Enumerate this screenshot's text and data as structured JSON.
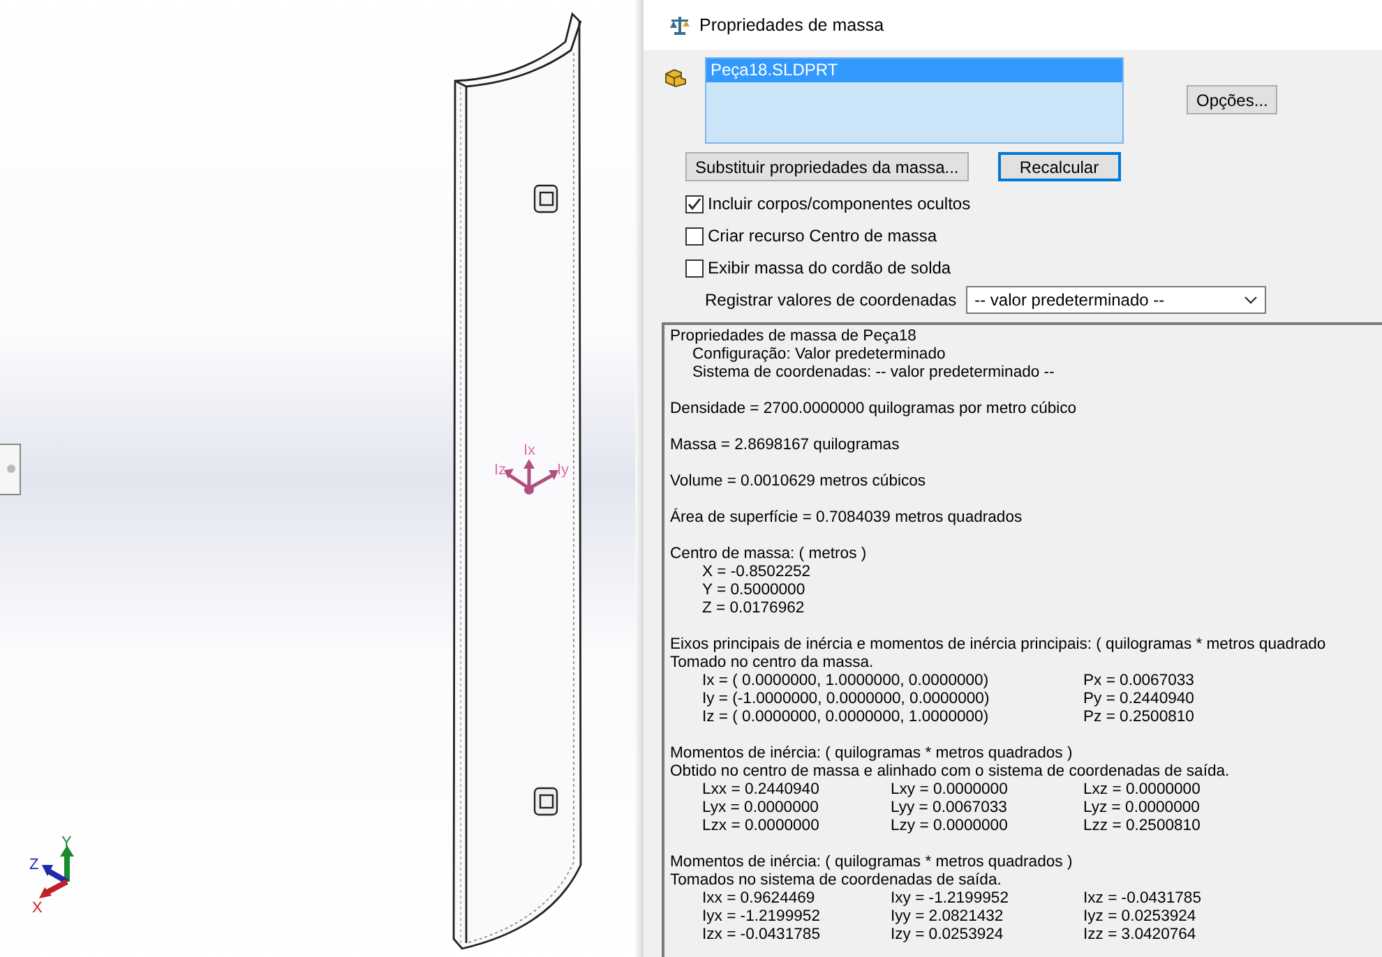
{
  "viewport": {
    "principal_axis_labels": [
      "Ix",
      "Iy",
      "Iz"
    ],
    "triad_labels": [
      "X",
      "Y",
      "Z"
    ]
  },
  "dialog": {
    "title": "Propriedades de massa",
    "selection": [
      {
        "label": "Peça18.SLDPRT",
        "selected": true
      }
    ],
    "options_button": "Opções...",
    "buttons": [
      {
        "label": "Substituir propriedades da massa...",
        "default": false
      },
      {
        "label": "Recalcular",
        "default": true
      }
    ],
    "checkboxes": [
      {
        "label": "Incluir corpos/componentes ocultos",
        "checked": true
      },
      {
        "label": "Criar recurso Centro de massa",
        "checked": false
      },
      {
        "label": "Exibir massa do cordão de solda",
        "checked": false
      }
    ],
    "coordinate_system": {
      "label": "Registrar valores de coordenadas",
      "value": "-- valor predeterminado --"
    },
    "results": [
      {
        "lines": [
          "Propriedades de massa de Peça18"
        ],
        "children": [
          "Configuração: Valor predeterminado",
          "Sistema de coordenadas: -- valor predeterminado --"
        ]
      },
      {
        "lines": [
          "Densidade = 2700.0000000 quilogramas por metro cúbico"
        ]
      },
      {
        "lines": [
          "Massa = 2.8698167 quilogramas"
        ]
      },
      {
        "lines": [
          "Volume = 0.0010629 metros cúbicos"
        ]
      },
      {
        "lines": [
          "Área de superfície = 0.7084039 metros quadrados"
        ]
      },
      {
        "lines": [
          "Centro de massa: ( metros )"
        ],
        "children": [
          "X = -0.8502252",
          "Y = 0.5000000",
          "Z = 0.0176962"
        ]
      },
      {
        "lines": [
          "Eixos principais de inércia e momentos de inércia principais: ( quilogramas * metros quadrado",
          "Tomado no centro da massa."
        ],
        "rows": [
          [
            "Ix = ( 0.0000000,  1.0000000,  0.0000000)",
            "Px = 0.0067033"
          ],
          [
            "Iy = (-1.0000000,  0.0000000,  0.0000000)",
            "Py = 0.2440940"
          ],
          [
            "Iz = ( 0.0000000,  0.0000000,  1.0000000)",
            "Pz = 0.2500810"
          ]
        ]
      },
      {
        "lines": [
          "Momentos de inércia: ( quilogramas * metros quadrados )",
          "Obtido no centro de massa e alinhado com o sistema de coordenadas de saída."
        ],
        "rows": [
          [
            "Lxx = 0.2440940",
            "Lxy = 0.0000000",
            "Lxz = 0.0000000"
          ],
          [
            "Lyx = 0.0000000",
            "Lyy = 0.0067033",
            "Lyz = 0.0000000"
          ],
          [
            "Lzx = 0.0000000",
            "Lzy = 0.0000000",
            "Lzz = 0.2500810"
          ]
        ]
      },
      {
        "lines": [
          "Momentos de inércia: ( quilogramas * metros quadrados )",
          "Tomados no sistema de coordenadas de saída."
        ],
        "rows": [
          [
            "Ixx = 0.9624469",
            "Ixy = -1.2199952",
            "Ixz = -0.0431785"
          ],
          [
            "Iyx = -1.2199952",
            "Iyy = 2.0821432",
            "Iyz = 0.0253924"
          ],
          [
            "Izx = -0.0431785",
            "Izy = 0.0253924",
            "Izz = 3.0420764"
          ]
        ]
      }
    ]
  }
}
